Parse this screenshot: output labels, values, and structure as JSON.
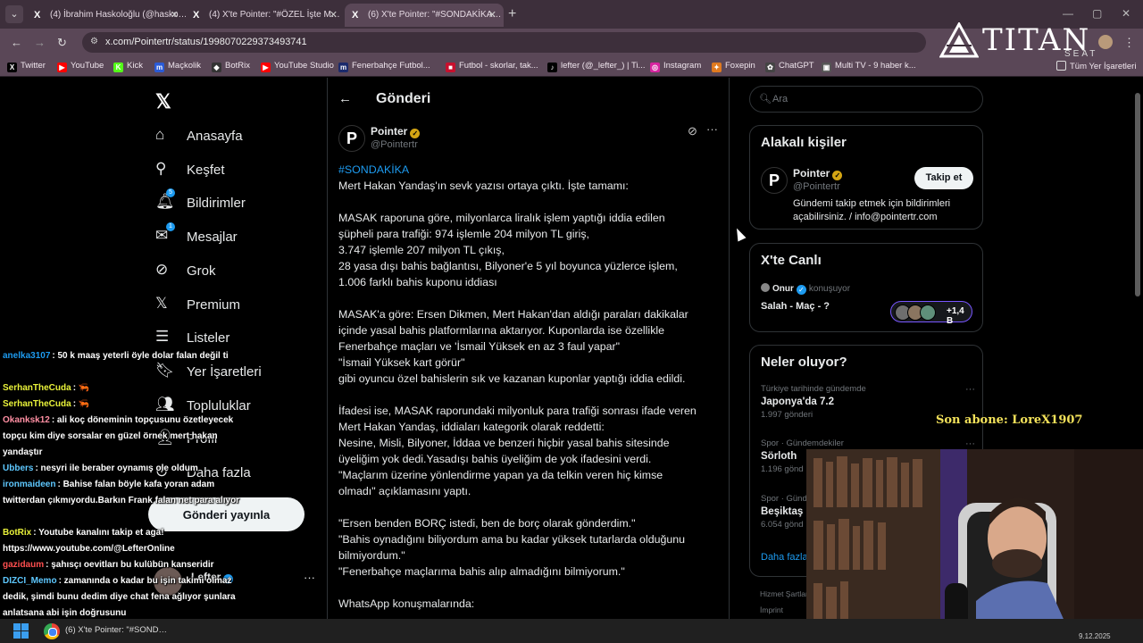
{
  "browser": {
    "tabs": [
      {
        "label": "(4) İbrahim Haskoloğlu (@hasko…",
        "favicon": "X"
      },
      {
        "label": "(4) X'te Pointer: \"#ÖZEL İşte M…",
        "favicon": "X"
      },
      {
        "label": "(6) X'te Pointer: \"#SONDAKİKA…",
        "favicon": "X"
      }
    ],
    "url": "x.com/Pointertr/status/1998070229373493741",
    "bookmarks": [
      {
        "label": "Twitter",
        "color": "#000000",
        "glyph": "X"
      },
      {
        "label": "YouTube",
        "color": "#ff0000",
        "glyph": "▶"
      },
      {
        "label": "Kick",
        "color": "#53fc18",
        "glyph": "K"
      },
      {
        "label": "Maçkolik",
        "color": "#2a5bd7",
        "glyph": "m"
      },
      {
        "label": "BotRix",
        "color": "#333333",
        "glyph": "◆"
      },
      {
        "label": "YouTube Studio",
        "color": "#ff0000",
        "glyph": "▶"
      },
      {
        "label": "Fenerbahçe Futbol...",
        "color": "#1b2a6b",
        "glyph": "m"
      },
      {
        "label": "Futbol - skorlar, tak...",
        "color": "#c8102e",
        "glyph": "■"
      },
      {
        "label": "lefter (@_lefter_) | Ti...",
        "color": "#000000",
        "glyph": "♪"
      },
      {
        "label": "Instagram",
        "color": "#d6249f",
        "glyph": "◎"
      },
      {
        "label": "Foxepin",
        "color": "#e07a1f",
        "glyph": "✦"
      },
      {
        "label": "ChatGPT",
        "color": "#444444",
        "glyph": "✿"
      },
      {
        "label": "Multi TV - 9 haber k...",
        "color": "#555555",
        "glyph": "▣"
      }
    ],
    "all_bookmarks": "Tüm Yer İşaretleri"
  },
  "overlay": {
    "brand": "TITAN",
    "brand_sub": "SEAT",
    "subscriber": "Son abone: LoreX1907"
  },
  "nav": {
    "items": [
      {
        "label": "Anasayfa",
        "icon": "home-icon"
      },
      {
        "label": "Keşfet",
        "icon": "search-icon"
      },
      {
        "label": "Bildirimler",
        "icon": "bell-icon",
        "badge": "5"
      },
      {
        "label": "Mesajlar",
        "icon": "mail-icon",
        "badge": "1"
      },
      {
        "label": "Grok",
        "icon": "grok-icon"
      },
      {
        "label": "Premium",
        "icon": "x-icon"
      },
      {
        "label": "Listeler",
        "icon": "list-icon"
      },
      {
        "label": "Yer İşaretleri",
        "icon": "bookmark-icon"
      },
      {
        "label": "Topluluklar",
        "icon": "people-icon"
      },
      {
        "label": "Profil",
        "icon": "profile-icon"
      },
      {
        "label": "Daha fazla",
        "icon": "more-icon"
      }
    ],
    "post_button": "Gönderi yayınla",
    "account_name": "Lefter"
  },
  "post": {
    "header_title": "Gönderi",
    "author_name": "Pointer",
    "author_handle": "@Pointertr",
    "lines": [
      "#SONDAKİKA",
      "Mert Hakan Yandaş'ın sevk yazısı ortaya çıktı. İşte tamamı:",
      "",
      "MASAK raporuna göre, milyonlarca liralık işlem yaptığı iddia edilen",
      "şüpheli para trafiği: 974 işlemle 204 milyon TL giriş,",
      "3.747 işlemle 207 milyon TL çıkış,",
      "28 yasa dışı bahis bağlantısı, Bilyoner'e 5 yıl boyunca yüzlerce işlem,",
      "1.006 farklı bahis kuponu iddiası",
      "",
      "MASAK'a göre: Ersen Dikmen, Mert Hakan'dan aldığı paraları dakikalar",
      "içinde yasal bahis platformlarına aktarıyor. Kuponlarda ise özellikle",
      "Fenerbahçe maçları ve 'İsmail Yüksek en az 3 faul yapar\"",
      " \"İsmail Yüksek kart görür\"",
      "gibi oyuncu özel bahislerin sık ve kazanan kuponlar yaptığı iddia edildi.",
      "",
      "İfadesi ise, MASAK raporundaki milyonluk para trafiği sonrası ifade veren",
      "Mert Hakan Yandaş, iddiaları kategorik olarak reddetti:",
      " Nesine, Misli, Bilyoner, İddaa ve benzeri hiçbir yasal bahis sitesinde",
      "üyeliğim yok dedi.Yasadışı bahis üyeliğim de yok ifadesini verdi.",
      "\"Maçlarım üzerine yönlendirme yapan ya da telkin veren hiç kimse",
      "olmadı\" açıklamasını yaptı.",
      "",
      "\"Ersen benden BORÇ istedi, ben de borç olarak gönderdim.\"",
      "\"Bahis oynadığını biliyordum ama bu kadar yüksek tutarlarda olduğunu",
      "bilmiyordum.\"",
      "\"Fenerbahçe maçlarıma bahis alıp almadığını bilmiyorum.\"",
      "",
      "WhatsApp konuşmalarında:"
    ]
  },
  "right": {
    "search_placeholder": "Ara",
    "related_title": "Alakalı kişiler",
    "related_name": "Pointer",
    "related_handle": "@Pointertr",
    "related_bio": "Gündemi takip etmek için bildirimleri açabilirsiniz. / info@pointertr.com",
    "follow_label": "Takip et",
    "live_title": "X'te Canlı",
    "live_user": "Onur",
    "live_status": "konuşuyor",
    "live_topic": "Salah - Maç - ?",
    "live_count": "+1,4 B",
    "trends_title": "Neler oluyor?",
    "trends": [
      {
        "context": "Türkiye tarihinde gündemde",
        "title": "Japonya'da 7.2",
        "count": "1.997 gönderi"
      },
      {
        "context": "Spor · Gündemdekiler",
        "title": "Sörloth",
        "count": "1.196 gönd"
      },
      {
        "context": "Spor · Gündemdekiler",
        "title": "Beşiktaş",
        "count": "6.054 gönd"
      }
    ],
    "show_more": "Daha fazla",
    "footer_1": "Hizmet Şartları",
    "footer_2": "İmprint"
  },
  "chat": [
    {
      "user": "anelka3107",
      "color": "#1d9bf0",
      "text": ": 50 k maaş yeterli öyle dolar falan değil ti"
    },
    {
      "user": "SerhanTheCuda",
      "color": "#e9f23a",
      "text": ": 🦐"
    },
    {
      "user": "SerhanTheCuda",
      "color": "#e9f23a",
      "text": ": 🦐"
    },
    {
      "user": "Okanksk12",
      "color": "#ff8fa3",
      "text": ": ali koç döneminin topçusunu özetleyecek topçu kim diye sorsalar en güzel örnek mert hakan yandaştır"
    },
    {
      "user": "Ubbers",
      "color": "#5ec8ff",
      "text": ": nesyri ile beraber oynamış ole oldum"
    },
    {
      "user": "ironmaideen",
      "color": "#5ec8ff",
      "text": ": Bahise falan böyle kafa yoran adam twitterdan çıkmıyordu.Barkın Frank falan net para alıyor"
    },
    {
      "user": "BotRix",
      "color": "#e9f23a",
      "text": ": Youtube kanalını takip et aga! https://www.youtube.com/@LefterOnline"
    },
    {
      "user": "gazidaum",
      "color": "#ff4f4f",
      "text": ": şahısçı oevitları bu kulübün kanseridir"
    },
    {
      "user": "DIZCI_Memo",
      "color": "#5ec8ff",
      "text": ": zamanında o kadar bu işin takimi olmaz dedik, şimdi bunu dedim diye chat fena ağlıyor şunlara anlatsana abi işin doğrusunu"
    }
  ],
  "taskbar": {
    "item": "(6) X'te Pointer: \"#SOND…",
    "date": "9.12.2025"
  }
}
